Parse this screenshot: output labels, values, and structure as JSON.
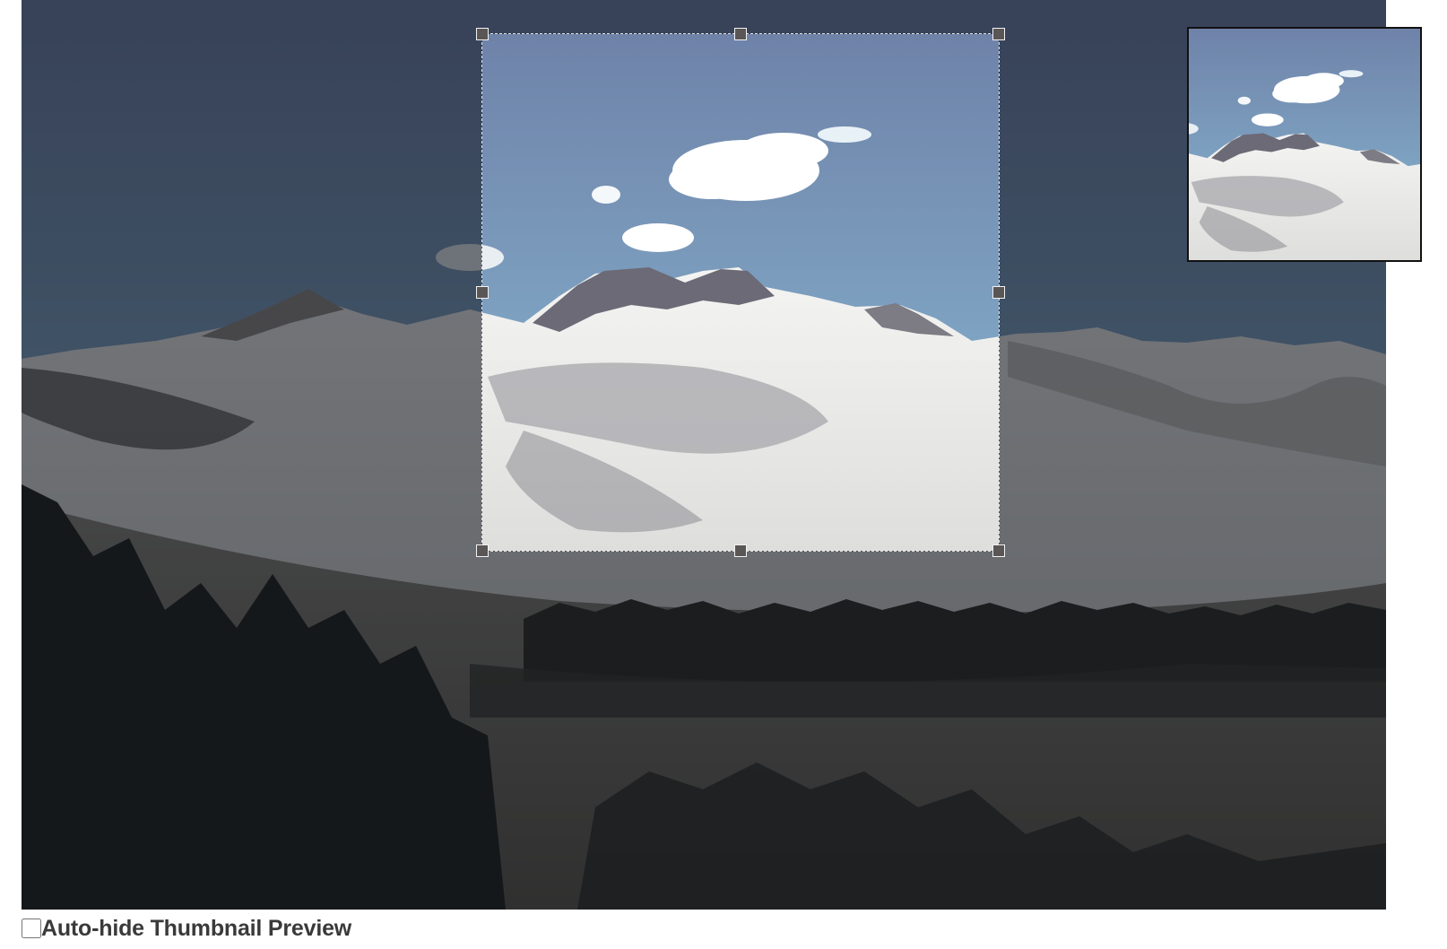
{
  "editor": {
    "image_alt": "Snow-covered mountain landscape with pine trees in the foreground",
    "overlay_dim": true
  },
  "crop_box": {
    "handles": [
      "nw",
      "n",
      "ne",
      "w",
      "e",
      "sw",
      "s",
      "se"
    ]
  },
  "thumbnail_preview": {
    "visible": true
  },
  "options": {
    "auto_hide_label": "Auto-hide Thumbnail Preview",
    "auto_hide_checked": false
  },
  "colors": {
    "sky_top": "#6e82a7",
    "sky_bottom": "#a9d2e3",
    "snow": "#eef0ef",
    "dim_overlay": "rgba(18,22,30,0.58)"
  }
}
